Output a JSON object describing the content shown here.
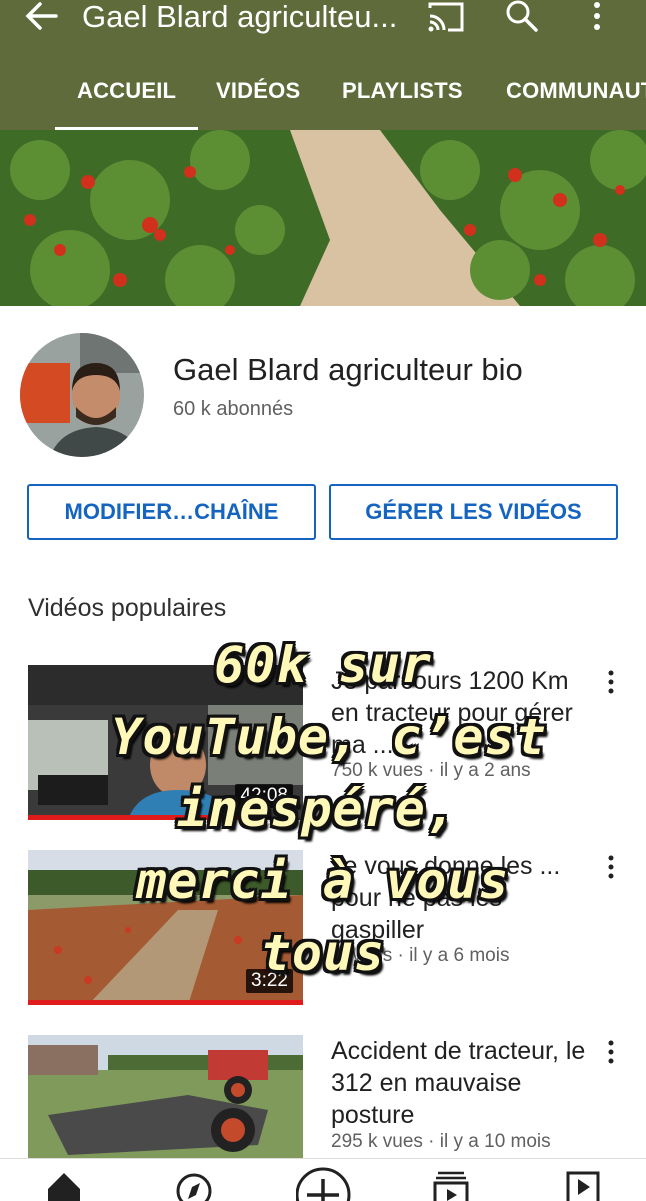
{
  "appbar": {
    "title": "Gael Blard agriculteu...",
    "icons": [
      "back-arrow-icon",
      "cast-icon",
      "search-icon",
      "more-vert-icon"
    ],
    "tabs": [
      {
        "label": "ACCUEIL",
        "active": true
      },
      {
        "label": "VIDÉOS",
        "active": false
      },
      {
        "label": "PLAYLISTS",
        "active": false
      },
      {
        "label": "COMMUNAUTÉ",
        "active": false
      }
    ]
  },
  "channel": {
    "name": "Gael Blard agriculteur bio",
    "subscribers": "60 k abonnés",
    "edit_button": "MODIFIER…CHAÎNE",
    "manage_button": "GÉRER LES VIDÉOS"
  },
  "popular": {
    "heading": "Vidéos populaires",
    "videos": [
      {
        "title": "Je parcours 1200 Km en tracteur pour gérer ma ...",
        "meta": "750 k vues · il y a 2 ans",
        "duration": "42:08",
        "progress": 0.8
      },
      {
        "title": "Je vous donne les ... pour ne pas les gaspiller",
        "meta": "... vues · il y a 6 mois",
        "duration": "3:22",
        "progress": 1.0
      },
      {
        "title": "Accident de tracteur, le 312 en mauvaise posture",
        "meta": "295 k vues · il y a 10 mois",
        "duration": "",
        "progress": 0
      }
    ]
  },
  "overlay": {
    "lines": [
      "60k sur",
      "YouTube, c’est",
      "inespéré,",
      "merci à vous",
      "tous"
    ]
  },
  "bottom_nav": {
    "icons": [
      "home-icon",
      "explore-icon",
      "add-icon",
      "subscriptions-icon",
      "library-icon"
    ]
  },
  "colors": {
    "appbar": "#5f6b3a",
    "accent": "#1565c0",
    "progress": "#e01b1b"
  }
}
